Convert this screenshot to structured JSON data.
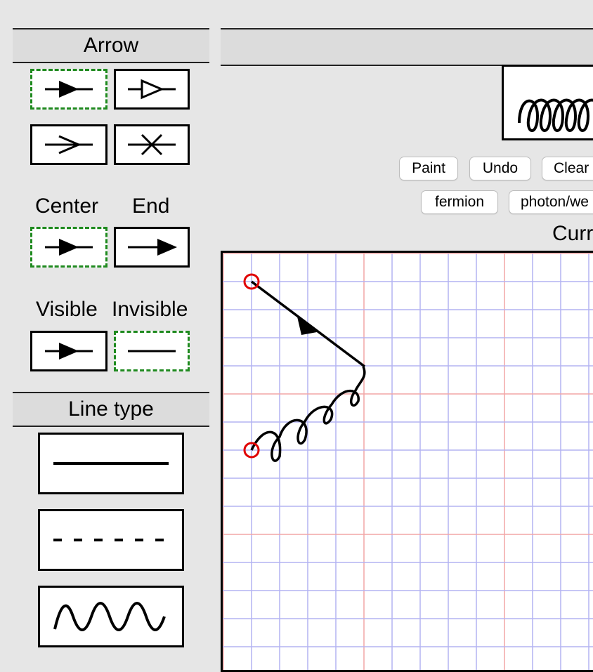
{
  "sidebar": {
    "arrow_section": {
      "title": "Arrow",
      "styles": [
        {
          "name": "filled-triangle",
          "selected": true
        },
        {
          "name": "hollow-triangle",
          "selected": false
        },
        {
          "name": "open-chevron",
          "selected": false
        },
        {
          "name": "cross",
          "selected": false
        }
      ],
      "position": {
        "center_label": "Center",
        "end_label": "End",
        "selected": "Center"
      },
      "visibility": {
        "visible_label": "Visible",
        "invisible_label": "Invisible",
        "selected": "Invisible"
      }
    },
    "line_type_section": {
      "title": "Line type",
      "types": [
        "solid",
        "dashed",
        "wavy"
      ]
    }
  },
  "toolbar": {
    "paint_label": "Paint",
    "undo_label": "Undo",
    "clear_label": "Clear",
    "fermion_label": "fermion",
    "photon_label": "photon/we"
  },
  "current_label": "Curr",
  "colors": {
    "background": "#e6e6e6",
    "selected_border": "#1f8a1f",
    "grid_minor": "#b3b3f2",
    "grid_major": "#f2a6a6",
    "vertex": "#e00000"
  },
  "canvas": {
    "lines": [
      {
        "type": "fermion",
        "arrow": "center"
      },
      {
        "type": "gluon"
      }
    ]
  }
}
